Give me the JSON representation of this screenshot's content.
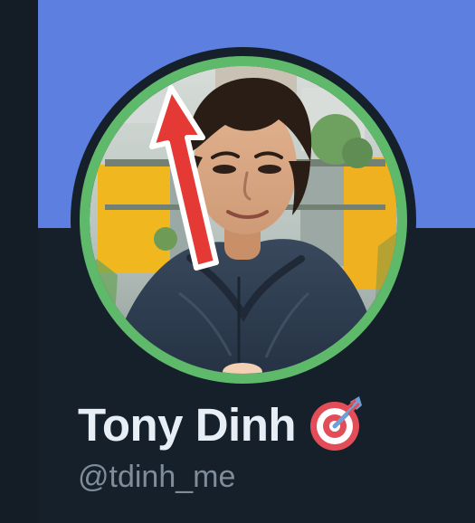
{
  "profile": {
    "display_name": "Tony Dinh",
    "handle": "@tdinh_me",
    "name_badge_icon": "target-dart-icon",
    "avatar_ring_color": "#5fb96a",
    "banner_color": "#5d80e0",
    "background_color": "#16202b"
  },
  "annotation": {
    "arrow_color": "#e53935",
    "arrow_icon": "arrow-up-icon"
  }
}
